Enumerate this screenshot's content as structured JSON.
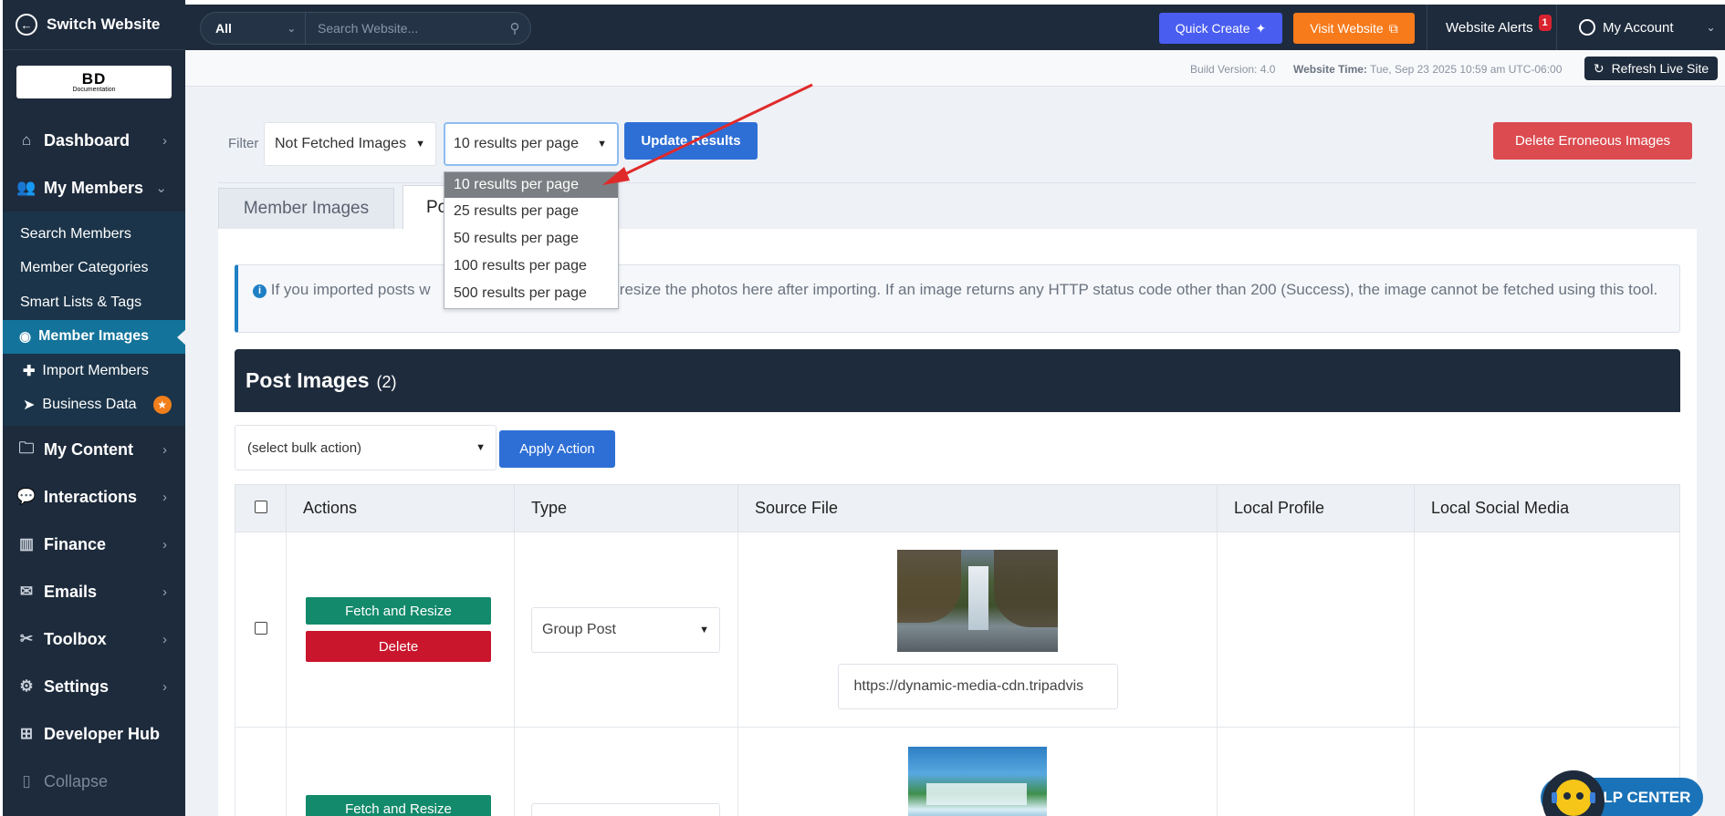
{
  "sidebar": {
    "switch_label": "Switch Website",
    "logo_text": "BD",
    "logo_sub": "Documentation",
    "items": [
      {
        "label": "Dashboard"
      },
      {
        "label": "My Members"
      },
      {
        "label": "My Content"
      },
      {
        "label": "Interactions"
      },
      {
        "label": "Finance"
      },
      {
        "label": "Emails"
      },
      {
        "label": "Toolbox"
      },
      {
        "label": "Settings"
      },
      {
        "label": "Developer Hub"
      },
      {
        "label": "Collapse"
      }
    ],
    "submenu": [
      {
        "label": "Search Members"
      },
      {
        "label": "Member Categories"
      },
      {
        "label": "Smart Lists & Tags"
      },
      {
        "label": "Member Images"
      },
      {
        "label": "Import Members"
      },
      {
        "label": "Business Data"
      }
    ]
  },
  "topbar": {
    "search_scope": "All",
    "search_placeholder": "Search Website...",
    "quick_create": "Quick Create",
    "visit_website": "Visit Website",
    "alerts_label": "Website Alerts",
    "alerts_count": "1",
    "account_label": "My Account"
  },
  "infobar": {
    "build": "Build Version: 4.0",
    "time_label": "Website Time:",
    "time_value": "Tue, Sep 23 2025 10:59 am UTC-06:00",
    "refresh": "Refresh Live Site"
  },
  "filters": {
    "label": "Filter",
    "status_value": "Not Fetched Images",
    "per_page_value": "10 results per page",
    "update_button": "Update Results",
    "delete_erroneous": "Delete Erroneous Images",
    "per_page_options": [
      "10 results per page",
      "25 results per page",
      "50 results per page",
      "100 results per page",
      "500 results per page"
    ]
  },
  "tabs": [
    {
      "label": "Member Images"
    },
    {
      "label": "Po"
    }
  ],
  "info_alert": {
    "text_start": "If you imported posts w",
    "text_end": "n and resize the photos here after importing. If an image returns any HTTP status code other than 200 (Success), the image cannot be fetched using this tool."
  },
  "card": {
    "title": "Post Images",
    "count": "(2)",
    "bulk_placeholder": "(select bulk action)",
    "apply_button": "Apply Action"
  },
  "table": {
    "headers": [
      "Actions",
      "Type",
      "Source File",
      "Local Profile",
      "Local Social Media"
    ],
    "rows": [
      {
        "fetch": "Fetch and Resize",
        "delete": "Delete",
        "type": "Group Post",
        "url": "https://dynamic-media-cdn.tripadvis"
      },
      {
        "fetch": "Fetch and Resize"
      }
    ]
  },
  "help": {
    "label": "ELP CENTER"
  }
}
